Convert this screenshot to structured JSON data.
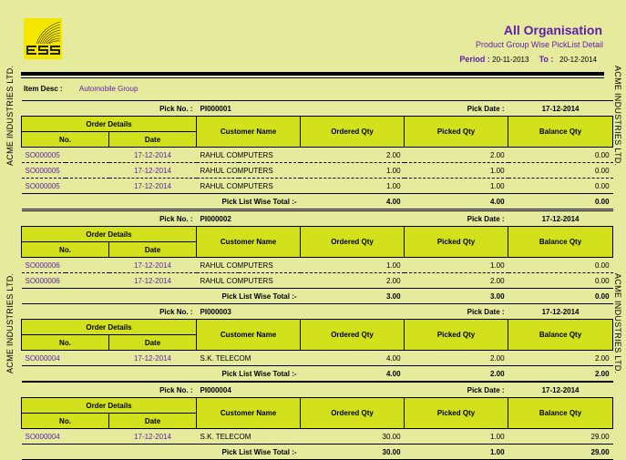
{
  "logo": {
    "text": "ESS"
  },
  "report": {
    "title": "All Organisation",
    "subtitle": "Product Group Wise PickList Detail",
    "period_label": "Period :",
    "period_from": "20-11-2013",
    "to_label": "To :",
    "period_to": "20-12-2014"
  },
  "side_text": "ACME INDUSTRIES LTD.",
  "item_desc": {
    "label": "Item Desc :",
    "value": "Automobile Group"
  },
  "labels": {
    "pick_no": "Pick No. :",
    "pick_date": "Pick Date :",
    "order_details": "Order Details",
    "no": "No.",
    "date": "Date",
    "customer_name": "Customer Name",
    "ordered_qty": "Ordered Qty",
    "picked_qty": "Picked Qty",
    "balance_qty": "Balance Qty",
    "total": "Pick List Wise Total :-"
  },
  "picklists": [
    {
      "pick_no": "PI000001",
      "pick_date": "17-12-2014",
      "rows": [
        {
          "no": "SO000005",
          "date": "17-12-2014",
          "customer": "RAHUL COMPUTERS",
          "ordered": "2.00",
          "picked": "2.00",
          "balance": "0.00"
        },
        {
          "no": "SO000005",
          "date": "17-12-2014",
          "customer": "RAHUL COMPUTERS",
          "ordered": "1.00",
          "picked": "1.00",
          "balance": "0.00"
        },
        {
          "no": "SO000005",
          "date": "17-12-2014",
          "customer": "RAHUL COMPUTERS",
          "ordered": "1.00",
          "picked": "1.00",
          "balance": "0.00"
        }
      ],
      "total": {
        "ordered": "4.00",
        "picked": "4.00",
        "balance": "0.00"
      }
    },
    {
      "pick_no": "PI000002",
      "pick_date": "17-12-2014",
      "rows": [
        {
          "no": "SO000006",
          "date": "17-12-2014",
          "customer": "RAHUL COMPUTERS",
          "ordered": "1.00",
          "picked": "1.00",
          "balance": "0.00"
        },
        {
          "no": "SO000006",
          "date": "17-12-2014",
          "customer": "RAHUL COMPUTERS",
          "ordered": "2.00",
          "picked": "2.00",
          "balance": "0.00"
        }
      ],
      "total": {
        "ordered": "3.00",
        "picked": "3.00",
        "balance": "0.00"
      }
    },
    {
      "pick_no": "PI000003",
      "pick_date": "17-12-2014",
      "rows": [
        {
          "no": "SO000004",
          "date": "17-12-2014",
          "customer": "S.K. TELECOM",
          "ordered": "4.00",
          "picked": "2.00",
          "balance": "2.00"
        }
      ],
      "total": {
        "ordered": "4.00",
        "picked": "2.00",
        "balance": "2.00"
      }
    },
    {
      "pick_no": "PI000004",
      "pick_date": "17-12-2014",
      "rows": [
        {
          "no": "SO000004",
          "date": "17-12-2014",
          "customer": "S.K. TELECOM",
          "ordered": "30.00",
          "picked": "1.00",
          "balance": "29.00"
        }
      ],
      "total": {
        "ordered": "30.00",
        "picked": "1.00",
        "balance": "29.00"
      }
    }
  ]
}
